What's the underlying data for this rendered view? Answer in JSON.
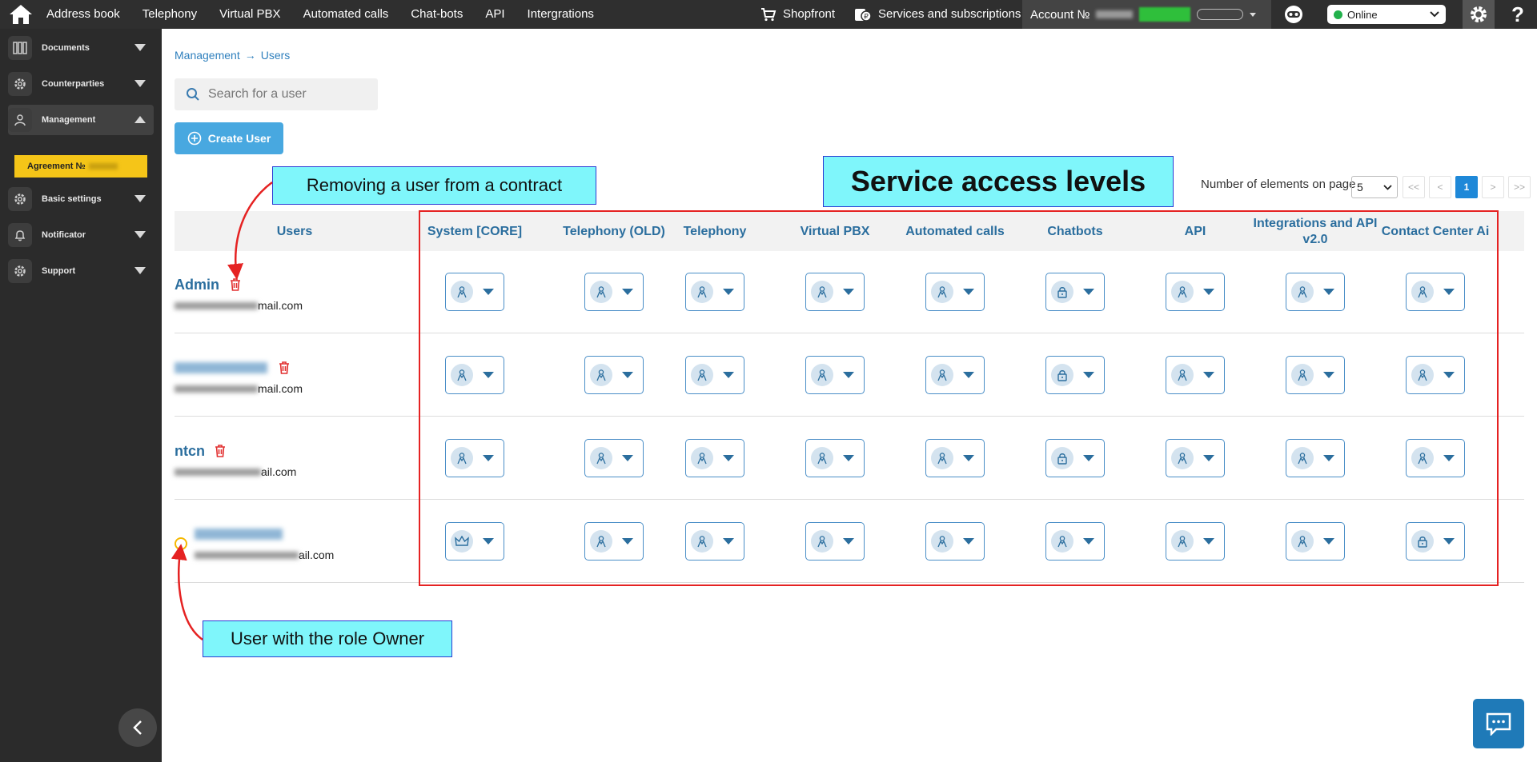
{
  "topbar": {
    "nav": [
      "Address book",
      "Telephony",
      "Virtual PBX",
      "Automated calls",
      "Chat-bots",
      "API",
      "Intergrations"
    ],
    "shopfront": "Shopfront",
    "services": "Services and subscriptions",
    "account_label": "Account №",
    "status": "Online"
  },
  "sidebar": {
    "items": [
      {
        "label": "Documents",
        "icon": "documents-icon"
      },
      {
        "label": "Counterparties",
        "icon": "gear-icon"
      },
      {
        "label": "Management",
        "icon": "user-icon"
      },
      {
        "label": "Basic settings",
        "icon": "gear-icon"
      },
      {
        "label": "Notificator",
        "icon": "bell-icon"
      },
      {
        "label": "Support",
        "icon": "gear-icon"
      }
    ],
    "agreement": "Agreement №"
  },
  "breadcrumb": {
    "root": "Management",
    "current": "Users"
  },
  "search": {
    "placeholder": "Search for a user"
  },
  "create_button": "Create User",
  "pagination": {
    "per_page_label": "Number of elements on page",
    "per_page_value": "5",
    "first": "<<",
    "prev": "<",
    "current": "1",
    "next": ">",
    "last": ">>"
  },
  "table": {
    "users_header": "Users",
    "columns": [
      "System [CORE]",
      "Telephony (OLD)",
      "Telephony",
      "Virtual PBX",
      "Automated calls",
      "Chatbots",
      "API",
      "Integrations and API v2.0",
      "Contact Center Ai"
    ],
    "rows": [
      {
        "name": "Admin",
        "email": "mail.com",
        "perms": [
          "user",
          "user",
          "user",
          "user",
          "user",
          "lock",
          "user",
          "user",
          "user"
        ]
      },
      {
        "name": "",
        "email": "mail.com",
        "perms": [
          "user",
          "user",
          "user",
          "user",
          "user",
          "lock",
          "user",
          "user",
          "user"
        ]
      },
      {
        "name": "ntcn",
        "email": "ail.com",
        "perms": [
          "user",
          "user",
          "user",
          "user",
          "user",
          "lock",
          "user",
          "user",
          "user"
        ]
      },
      {
        "name": "",
        "email": "ail.com",
        "owner": true,
        "perms": [
          "crown",
          "user",
          "user",
          "user",
          "user",
          "user",
          "user",
          "user",
          "lock"
        ]
      }
    ]
  },
  "annotations": {
    "title": "Service access levels",
    "remove": "Removing a user from a contract",
    "owner": "User with the role Owner"
  },
  "colors": {
    "accent": "#2b6e9e",
    "button": "#48a8e0",
    "highlight": "#7ff6fb",
    "frame": "#e52222",
    "agreement": "#f5c518"
  }
}
